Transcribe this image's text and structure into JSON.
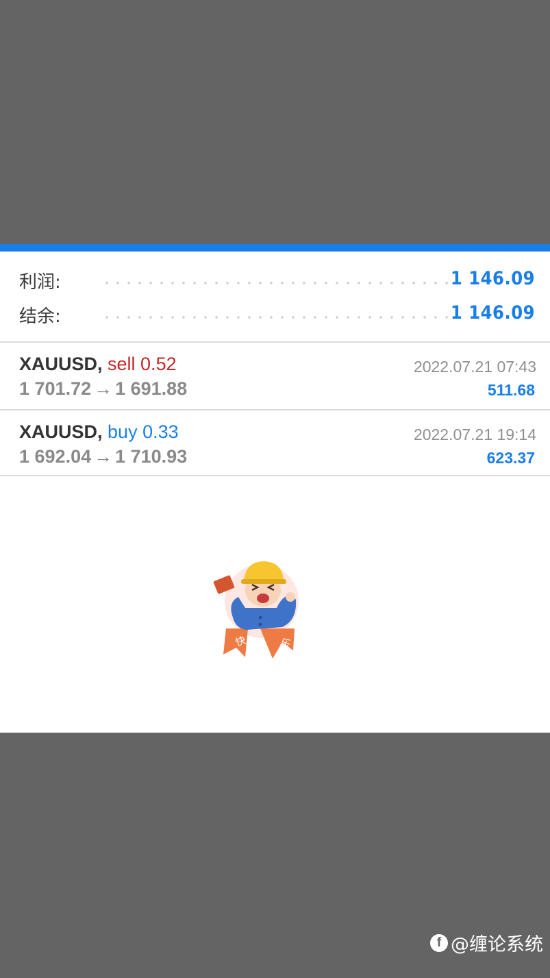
{
  "summary": {
    "profit_label": "利润:",
    "profit_value": "1 146.09",
    "balance_label": "结余:",
    "balance_value": "1 146.09"
  },
  "trades": [
    {
      "symbol": "XAUUSD,",
      "side_text": "sell 0.52",
      "side": "sell",
      "open_price": "1 701.72",
      "arrow": "→",
      "close_price": "1 691.88",
      "time": "2022.07.21 07:43",
      "profit": "511.68"
    },
    {
      "symbol": "XAUUSD,",
      "side_text": "buy 0.33",
      "side": "buy",
      "open_price": "1 692.04",
      "arrow": "→",
      "close_price": "1 710.93",
      "time": "2022.07.21 19:14",
      "profit": "623.37"
    }
  ],
  "mascot": {
    "icon": "worker-mascot-sticker",
    "ribbon_text_left": "快",
    "ribbon_text_right": "乐"
  },
  "watermark": {
    "icon": "f",
    "text": "@缠论系统"
  },
  "colors": {
    "accent": "#1a7ee8",
    "sell": "#c62828",
    "buy": "#1a7ee8",
    "backdrop": "#646464"
  }
}
